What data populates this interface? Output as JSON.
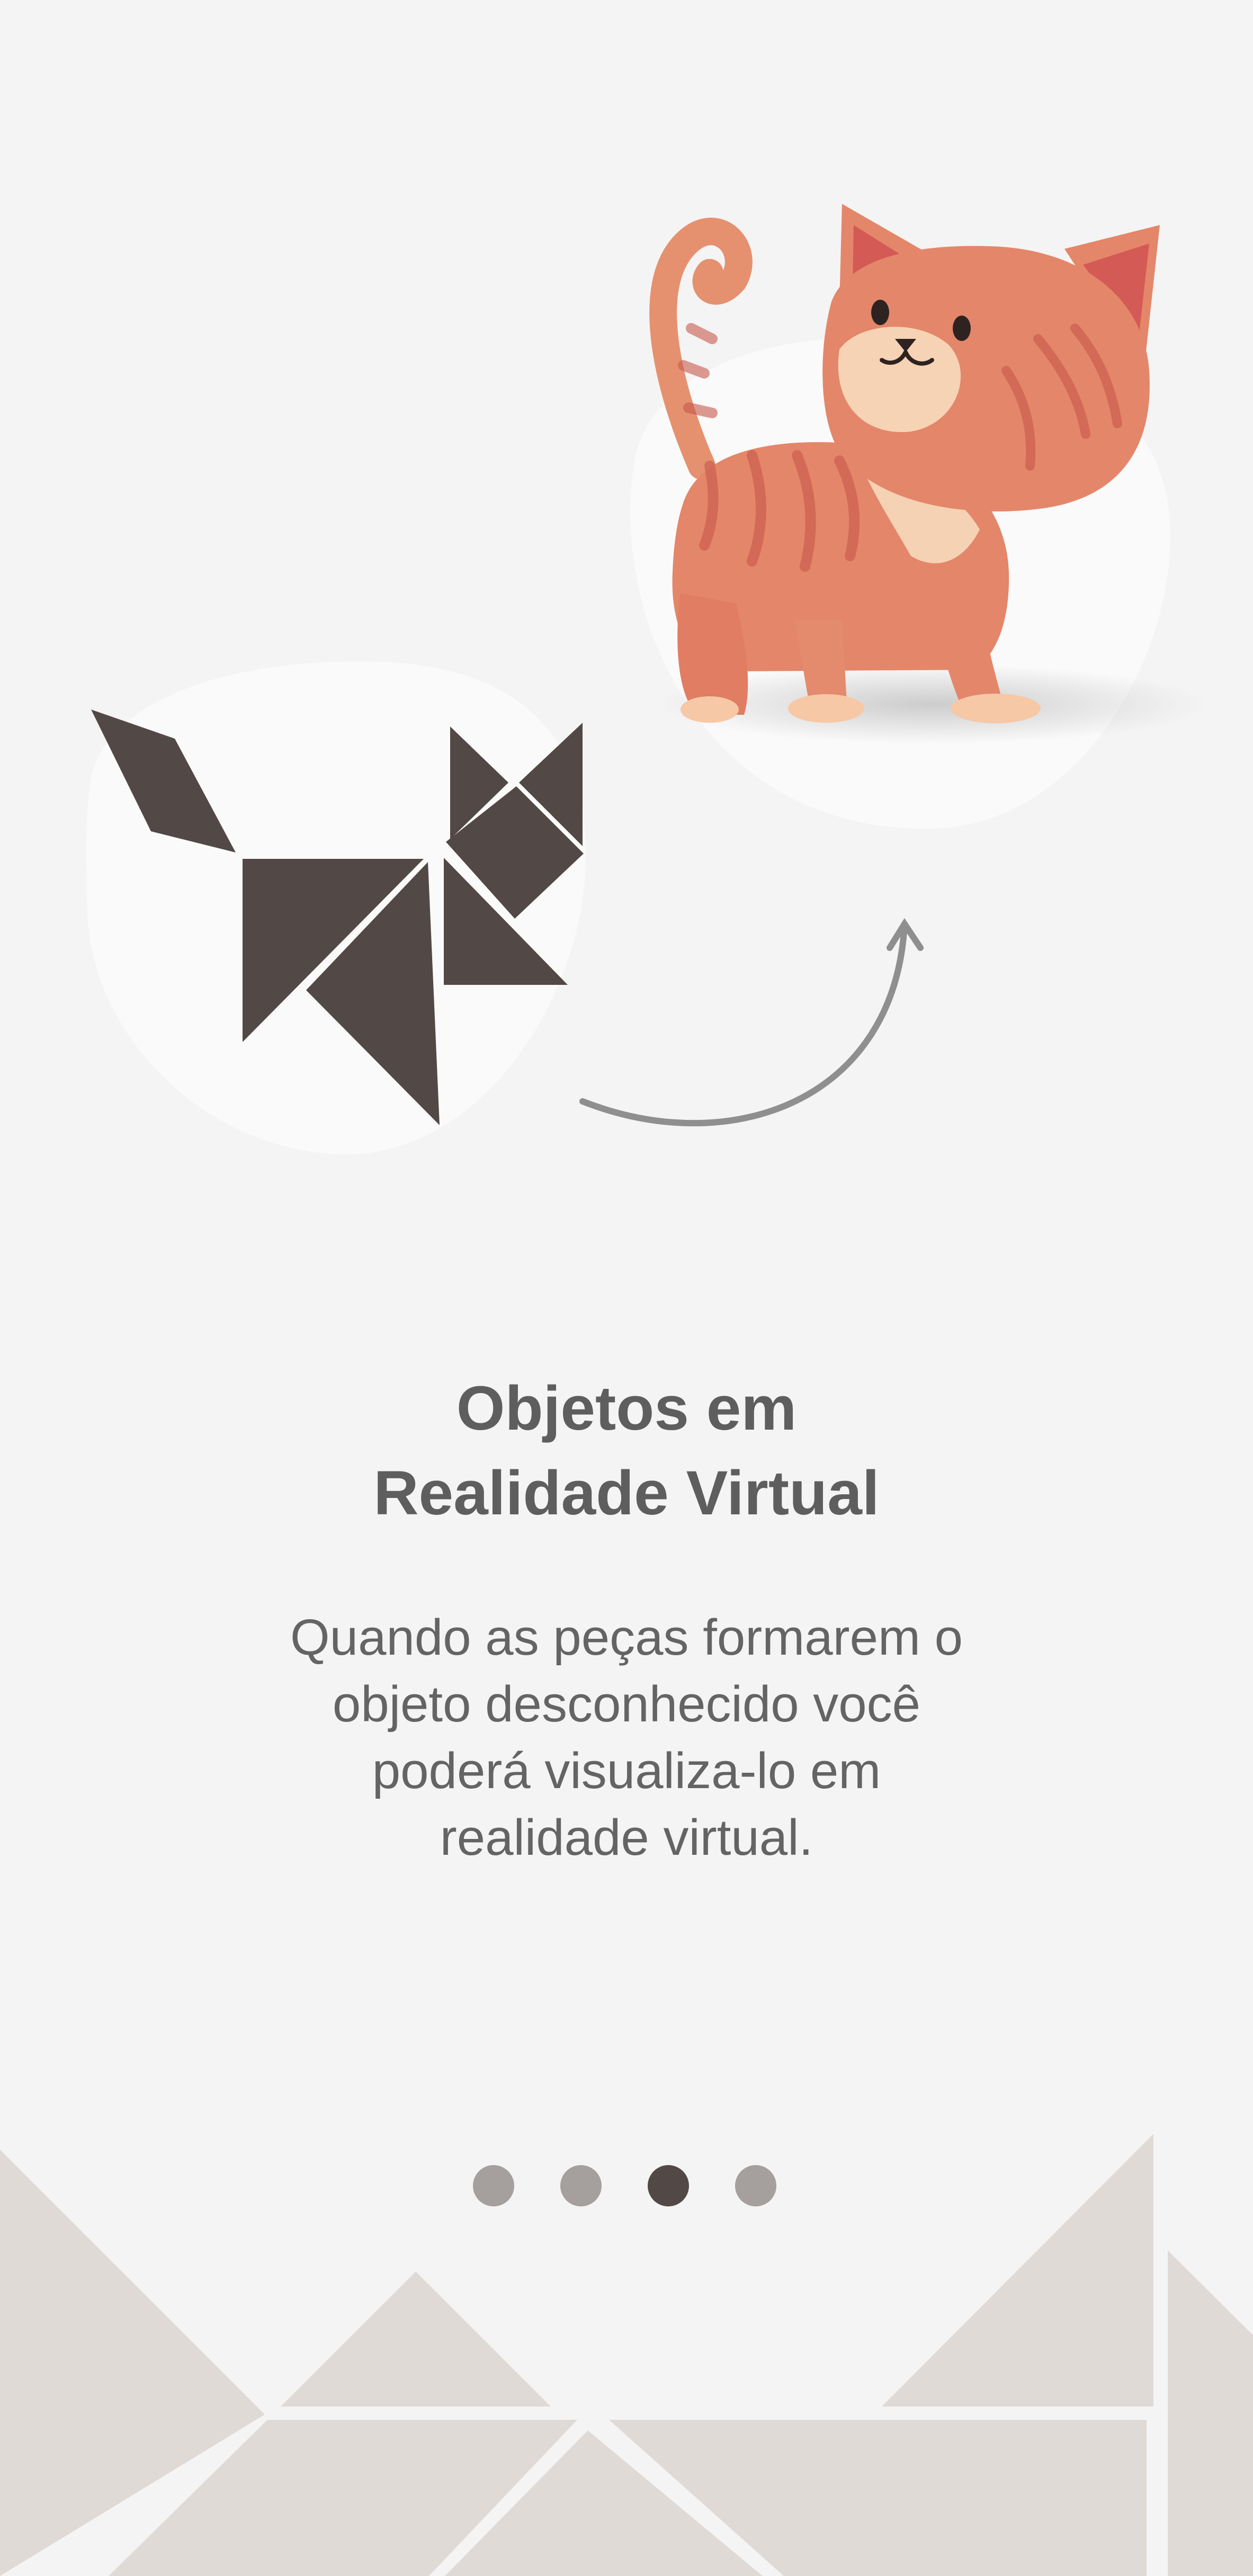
{
  "onboarding": {
    "title_lines": [
      "Objetos em",
      "Realidade Virtual"
    ],
    "description_lines": [
      "Quando as peças formarem o",
      "objeto desconhecido você",
      "poderá visualiza-lo em",
      "realidade virtual."
    ]
  },
  "pager": {
    "total_pages": 4,
    "current_page": 3
  },
  "colors": {
    "background": "#f4f4f4",
    "tangram": "#524845",
    "footer_shapes": "#e0dad7",
    "dot_inactive": "#a59f9d",
    "dot_active": "#524845",
    "text": "#5e5e5e",
    "cat_body": "#e4866a",
    "arrow": "#8f8f8f"
  },
  "icons": {
    "tangram": "tangram-cat-icon",
    "cat": "cat-illustration",
    "arrow": "curved-arrow-icon"
  }
}
